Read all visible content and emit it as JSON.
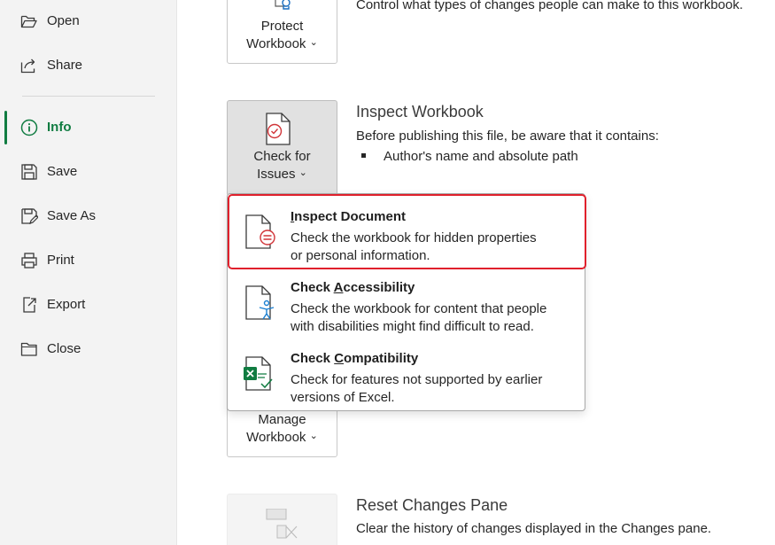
{
  "sidebar": {
    "items": [
      {
        "label": "Open",
        "icon": "folder-open-icon"
      },
      {
        "label": "Share",
        "icon": "share-icon"
      },
      {
        "label": "Info",
        "icon": "info-icon"
      },
      {
        "label": "Save",
        "icon": "save-icon"
      },
      {
        "label": "Save As",
        "icon": "save-as-icon"
      },
      {
        "label": "Print",
        "icon": "print-icon"
      },
      {
        "label": "Export",
        "icon": "export-icon"
      },
      {
        "label": "Close",
        "icon": "close-folder-icon"
      }
    ],
    "active": "Info"
  },
  "protect": {
    "tile_line1": "Protect",
    "tile_line2": "Workbook",
    "desc": "Control what types of changes people can make to this workbook."
  },
  "inspect": {
    "tile_line1": "Check for",
    "tile_line2": "Issues",
    "title": "Inspect Workbook",
    "desc": "Before publishing this file, be aware that it contains:",
    "bullet": "Author's name and absolute path"
  },
  "menu": {
    "items": [
      {
        "title_pre": "",
        "title_key": "I",
        "title_post": "nspect Document",
        "desc_line1": "Check the workbook for hidden properties",
        "desc_line2": "or personal information."
      },
      {
        "title_pre": "Check ",
        "title_key": "A",
        "title_post": "ccessibility",
        "desc_line1": "Check the workbook for content that people",
        "desc_line2": "with disabilities might find difficult to read."
      },
      {
        "title_pre": "Check ",
        "title_key": "C",
        "title_post": "ompatibility",
        "desc_line1": "Check for features not supported by earlier",
        "desc_line2": "versions of Excel."
      }
    ]
  },
  "manage": {
    "tile_line1": "Manage",
    "tile_line2": "Workbook"
  },
  "reset": {
    "title": "Reset Changes Pane",
    "desc": "Clear the history of changes displayed in the Changes pane."
  },
  "chevron": "⌄",
  "colors": {
    "accent": "#107c41",
    "highlight": "#e0202c",
    "accessibility": "#1a7fd1",
    "excel": "#107c41"
  }
}
